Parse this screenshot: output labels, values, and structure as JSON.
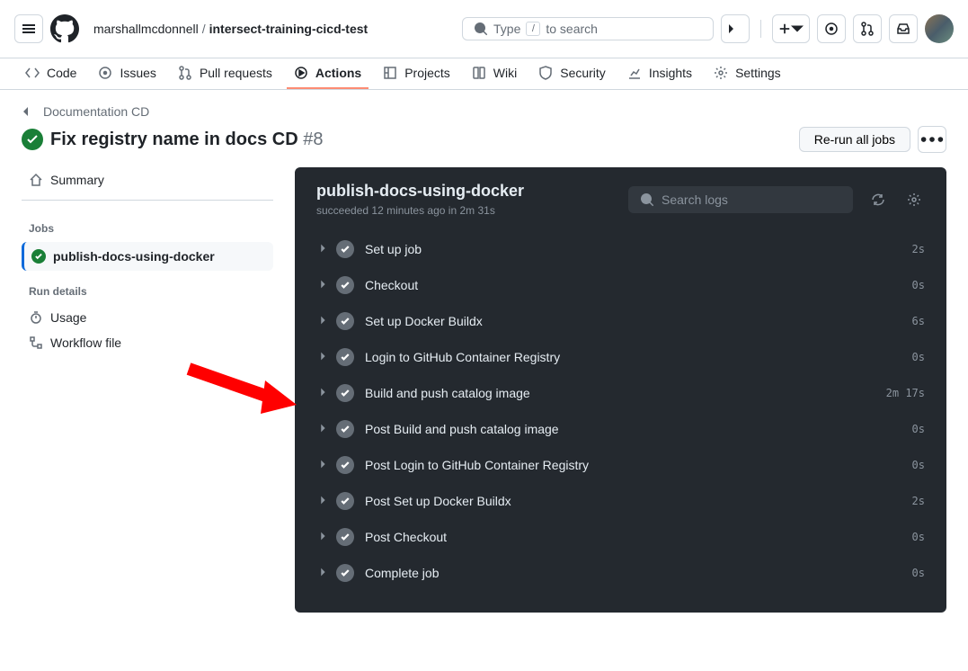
{
  "header": {
    "owner": "marshallmcdonnell",
    "repo": "intersect-training-cicd-test",
    "search_placeholder_prefix": "Type",
    "search_key": "/",
    "search_placeholder_suffix": "to search"
  },
  "repo_nav": {
    "code": "Code",
    "issues": "Issues",
    "pull_requests": "Pull requests",
    "actions": "Actions",
    "projects": "Projects",
    "wiki": "Wiki",
    "security": "Security",
    "insights": "Insights",
    "settings": "Settings"
  },
  "run": {
    "back_label": "Documentation CD",
    "title": "Fix registry name in docs CD",
    "number": "#8",
    "rerun_label": "Re-run all jobs"
  },
  "sidebar": {
    "summary": "Summary",
    "jobs_label": "Jobs",
    "job_name": "publish-docs-using-docker",
    "run_details_label": "Run details",
    "usage": "Usage",
    "workflow_file": "Workflow file"
  },
  "log": {
    "title": "publish-docs-using-docker",
    "subtitle_prefix": "succeeded",
    "subtitle_time": "12 minutes ago",
    "subtitle_in": "in",
    "subtitle_duration": "2m 31s",
    "search_placeholder": "Search logs",
    "steps": [
      {
        "name": "Set up job",
        "duration": "2s"
      },
      {
        "name": "Checkout",
        "duration": "0s"
      },
      {
        "name": "Set up Docker Buildx",
        "duration": "6s"
      },
      {
        "name": "Login to GitHub Container Registry",
        "duration": "0s"
      },
      {
        "name": "Build and push catalog image",
        "duration": "2m 17s"
      },
      {
        "name": "Post Build and push catalog image",
        "duration": "0s"
      },
      {
        "name": "Post Login to GitHub Container Registry",
        "duration": "0s"
      },
      {
        "name": "Post Set up Docker Buildx",
        "duration": "2s"
      },
      {
        "name": "Post Checkout",
        "duration": "0s"
      },
      {
        "name": "Complete job",
        "duration": "0s"
      }
    ]
  }
}
